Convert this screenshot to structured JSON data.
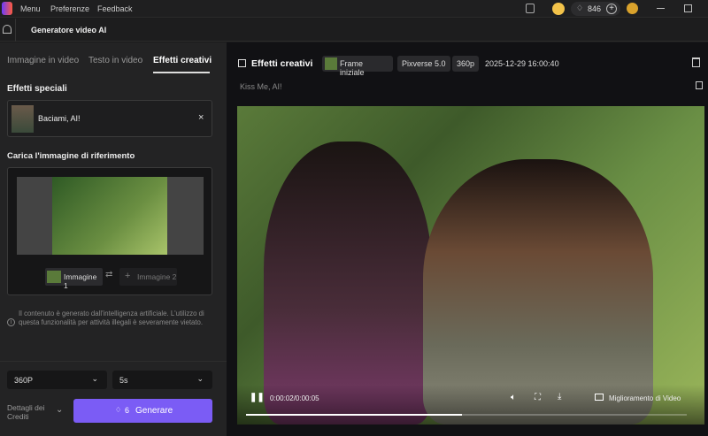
{
  "topbar": {
    "menu": "Menu",
    "preferences": "Preferenze",
    "feedback": "Feedback",
    "credits": "846"
  },
  "subbar": {
    "title": "Generatore video AI"
  },
  "left": {
    "tabs": [
      {
        "label": "Immagine in video"
      },
      {
        "label": "Testo in video"
      },
      {
        "label": "Effetti creativi"
      }
    ],
    "special_effects_title": "Effetti speciali",
    "effect_name": "Baciami, AI!",
    "upload_title": "Carica l'immagine di riferimento",
    "image1": "Immagine 1",
    "image2": "Immagine 2",
    "disclaimer": "Il contenuto è generato dall'intelligenza artificiale. L'utilizzo di questa funzionalità per attività illegali è severamente vietato.",
    "resolution": "360P",
    "duration": "5s",
    "credits_details": "Dettagli dei Crediti",
    "cost": "6",
    "generate": "Generare"
  },
  "right": {
    "title": "Effetti creativi",
    "frame_chip": "Frame iniziale",
    "model_chip": "Pixverse 5.0",
    "res_chip": "360p",
    "timestamp": "2025-12-29 16:00:40",
    "prompt": "Kiss Me, AI!",
    "player": {
      "time": "0:00:02/0:00:05",
      "enhance": "Miglioramento di Video",
      "progress": 0.49
    }
  },
  "colors": {
    "accent": "#7b5cf5"
  }
}
